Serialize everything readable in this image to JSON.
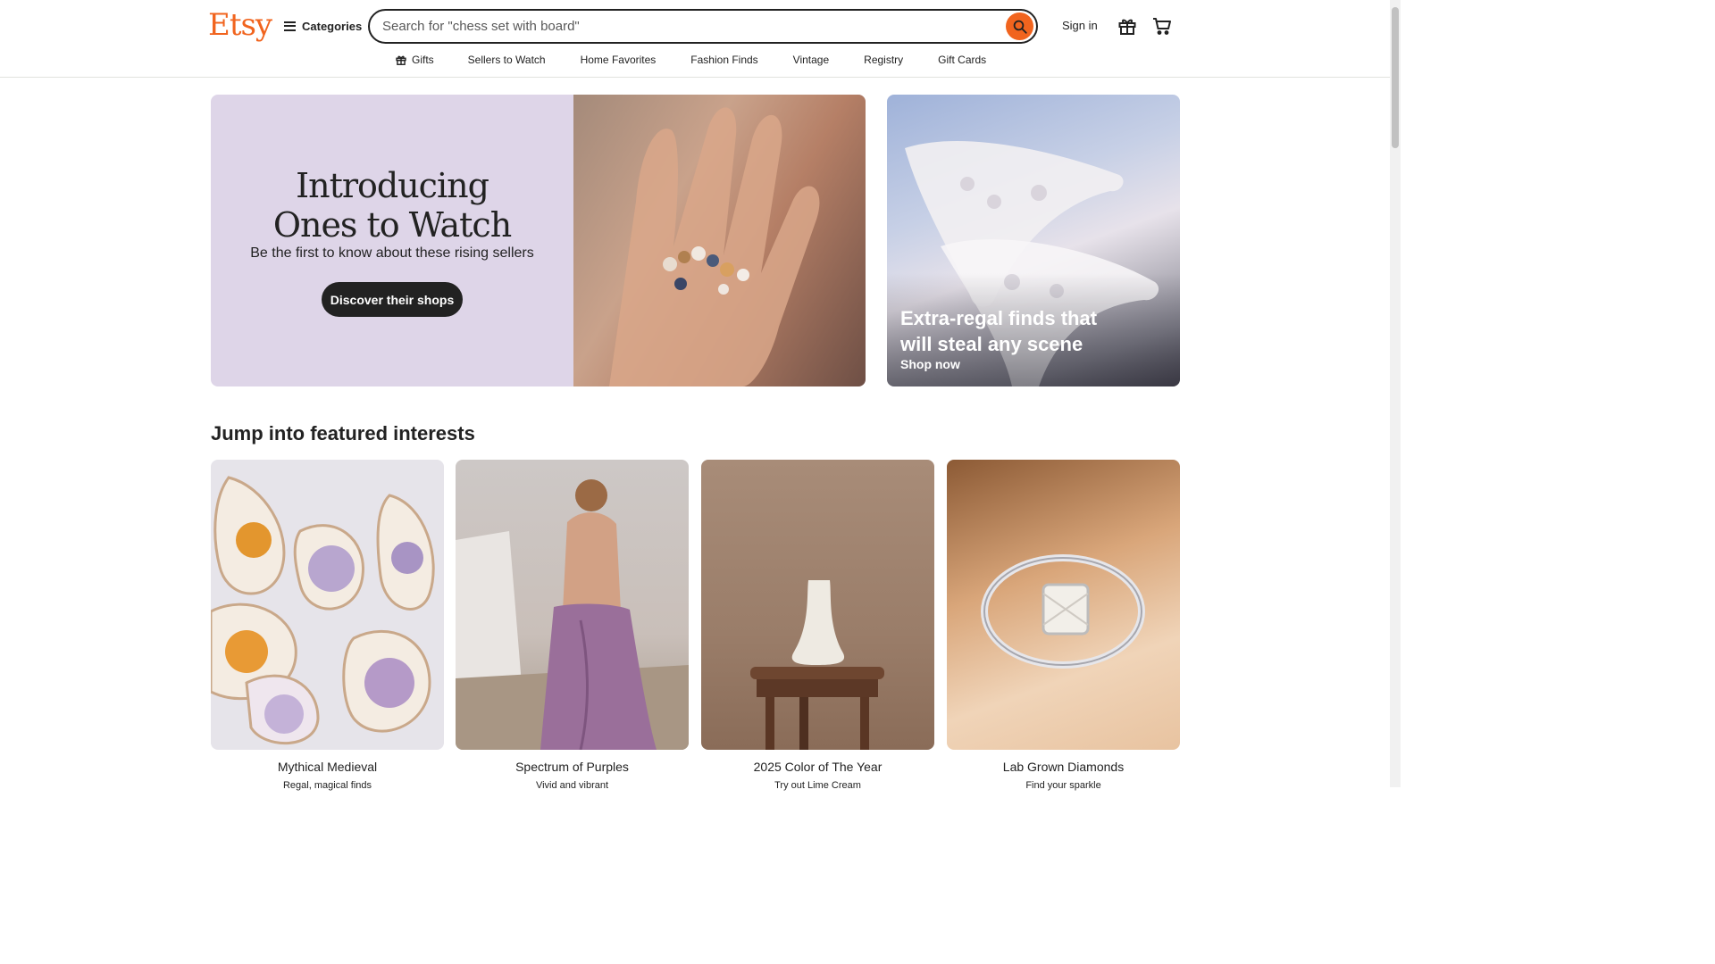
{
  "header": {
    "logo": "Etsy",
    "categories_label": "Categories",
    "search_placeholder": "Search for \"chess set with board\"",
    "signin_label": "Sign in",
    "brand_color": "#f1641e"
  },
  "nav": {
    "items": [
      {
        "label": "Gifts",
        "icon": "gift-icon"
      },
      {
        "label": "Sellers to Watch"
      },
      {
        "label": "Home Favorites"
      },
      {
        "label": "Fashion Finds"
      },
      {
        "label": "Vintage"
      },
      {
        "label": "Registry"
      },
      {
        "label": "Gift Cards"
      }
    ]
  },
  "hero": {
    "title_line1": "Introducing",
    "title_line2": "Ones to Watch",
    "subtitle": "Be the first to know about these rising sellers",
    "button_label": "Discover their shops",
    "bg_color": "#ded5e8"
  },
  "side_card": {
    "title": "Extra-regal finds that will steal any scene",
    "link_label": "Shop now"
  },
  "featured": {
    "heading": "Jump into featured interests",
    "cards": [
      {
        "title": "Mythical Medieval",
        "subtitle": "Regal, magical finds"
      },
      {
        "title": "Spectrum of Purples",
        "subtitle": "Vivid and vibrant"
      },
      {
        "title": "2025 Color of The Year",
        "subtitle": "Try out Lime Cream"
      },
      {
        "title": "Lab Grown Diamonds",
        "subtitle": "Find your sparkle"
      }
    ]
  }
}
